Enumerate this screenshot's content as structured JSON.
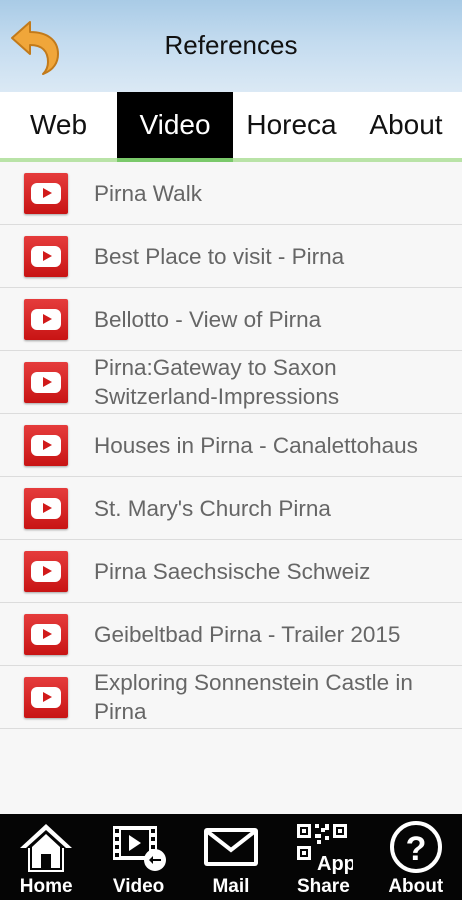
{
  "header": {
    "title": "References"
  },
  "tabs": [
    {
      "label": "Web",
      "active": false
    },
    {
      "label": "Video",
      "active": true
    },
    {
      "label": "Horeca",
      "active": false
    },
    {
      "label": "About",
      "active": false
    }
  ],
  "videos": [
    {
      "title": "Pirna Walk"
    },
    {
      "title": "Best Place to visit - Pirna"
    },
    {
      "title": "Bellotto - View of Pirna"
    },
    {
      "title": "Pirna:Gateway to Saxon Switzerland-Impressions"
    },
    {
      "title": "Houses in Pirna - Canalettohaus"
    },
    {
      "title": "St. Mary's Church Pirna"
    },
    {
      "title": "Pirna Saechsische Schweiz"
    },
    {
      "title": "Geibeltbad Pirna - Trailer 2015"
    },
    {
      "title": "Exploring Sonnenstein Castle in Pirna"
    }
  ],
  "bottom_nav": [
    {
      "label": "Home",
      "icon": "home-icon"
    },
    {
      "label": "Video",
      "icon": "video-icon"
    },
    {
      "label": "Mail",
      "icon": "mail-icon"
    },
    {
      "label": "Share",
      "icon": "qr-app-icon"
    },
    {
      "label": "About",
      "icon": "question-icon"
    }
  ],
  "colors": {
    "accent_green": "#b9e3a7",
    "youtube_red": "#d11a1a",
    "back_arrow": "#f0a63a"
  }
}
